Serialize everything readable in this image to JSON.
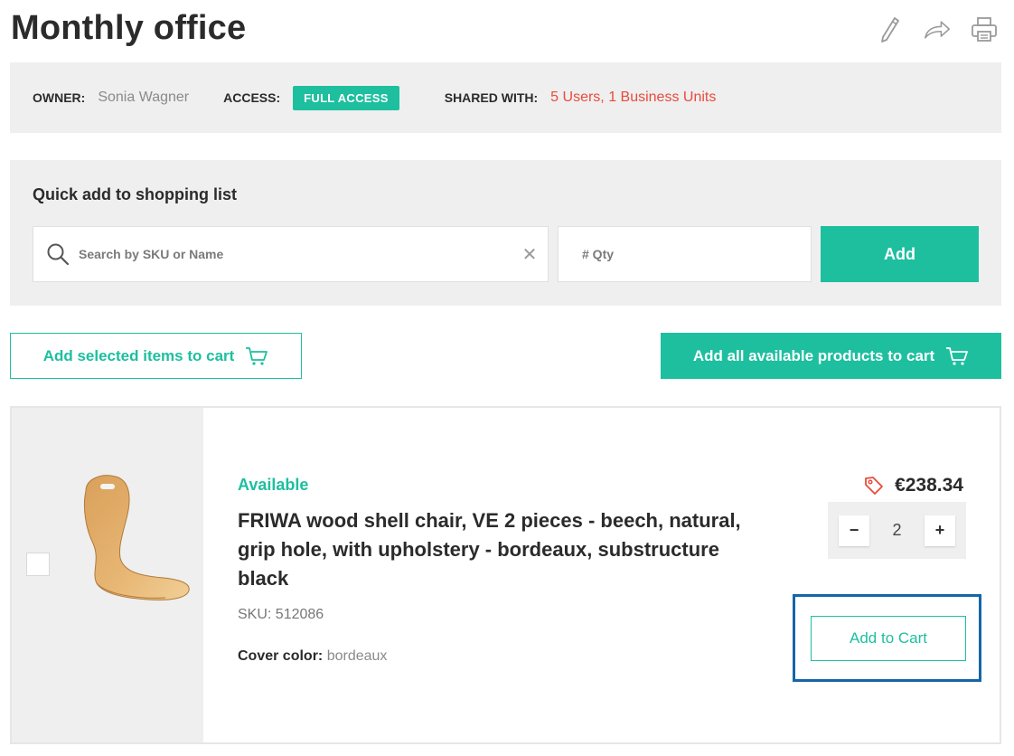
{
  "page": {
    "title": "Monthly office",
    "toolbar": {
      "edit_icon": "pencil-icon",
      "share_icon": "share-icon",
      "print_icon": "print-icon"
    }
  },
  "meta": {
    "owner_label": "OWNER:",
    "owner_value": "Sonia Wagner",
    "access_label": "ACCESS:",
    "access_badge": "FULL ACCESS",
    "shared_label": "SHARED WITH:",
    "shared_value": "5 Users, 1 Business Units"
  },
  "quick_add": {
    "title": "Quick add to shopping list",
    "search_placeholder": "Search by SKU or Name",
    "clear_symbol": "✕",
    "qty_placeholder": "# Qty",
    "add_label": "Add"
  },
  "actions": {
    "add_selected_label": "Add selected items to cart",
    "add_all_label": "Add all available products to cart"
  },
  "product": {
    "availability": "Available",
    "name": "FRIWA wood shell chair, VE 2 pieces - beech, natural, grip hole, with upholstery - bordeaux, substructure black",
    "sku": "SKU: 512086",
    "cover_label": "Cover color:",
    "cover_value": "bordeaux",
    "price": "€238.34",
    "quantity": "2",
    "minus": "−",
    "plus": "+",
    "add_to_cart_label": "Add to Cart"
  },
  "colors": {
    "accent": "#1dbf9f",
    "shared_text": "#e84b3c",
    "focus_ring": "#1565a8"
  }
}
